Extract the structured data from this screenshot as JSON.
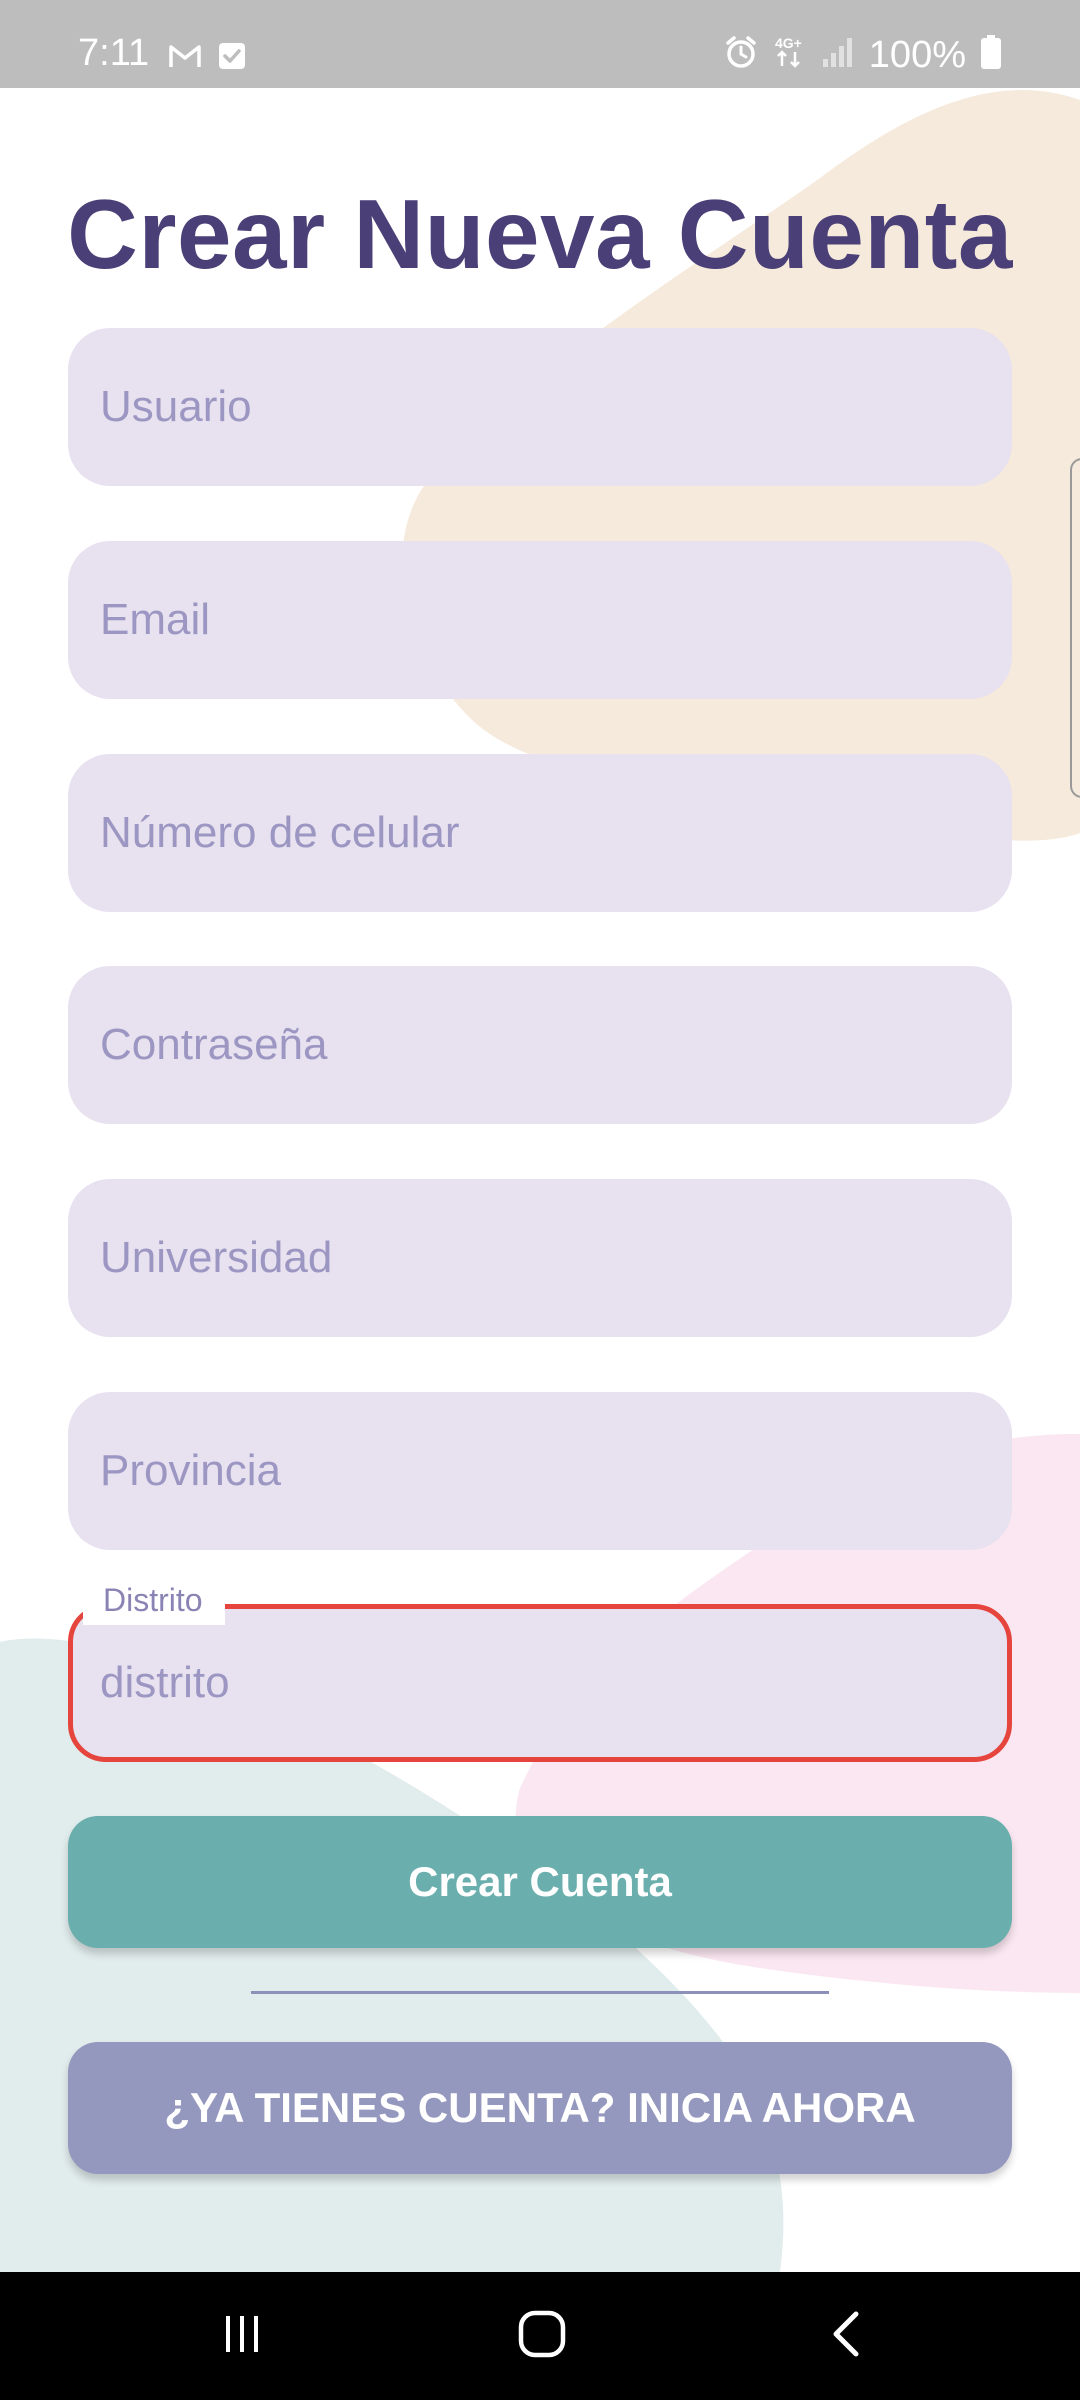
{
  "status_bar": {
    "time": "7:11",
    "battery": "100%",
    "icons": [
      "gmail-icon",
      "check-icon",
      "alarm-icon",
      "4g-icon",
      "signal-icon",
      "battery-icon"
    ]
  },
  "form": {
    "title": "Crear Nueva Cuenta",
    "fields": {
      "username": {
        "placeholder": "Usuario"
      },
      "email": {
        "placeholder": "Email"
      },
      "phone": {
        "placeholder": "Número de celular"
      },
      "password": {
        "placeholder": "Contraseña"
      },
      "university": {
        "placeholder": "Universidad"
      },
      "province": {
        "placeholder": "Provincia"
      },
      "district": {
        "label": "Distrito",
        "placeholder": "distrito"
      }
    },
    "create_button": "Crear Cuenta",
    "login_button": "¿YA TIENES CUENTA? INICIA AHORA"
  },
  "nav_bar": {
    "icons": [
      "recent-apps-icon",
      "home-icon",
      "back-icon"
    ]
  },
  "colors": {
    "title": "#4a3f76",
    "field_bg": "#e8e1ef",
    "error_border": "#e5453d",
    "primary_button": "#6aafad",
    "secondary_button": "#9598be",
    "blob_orange": "#f6eadc",
    "blob_pink": "#fbe7f1",
    "blob_teal": "#e1ecec"
  }
}
